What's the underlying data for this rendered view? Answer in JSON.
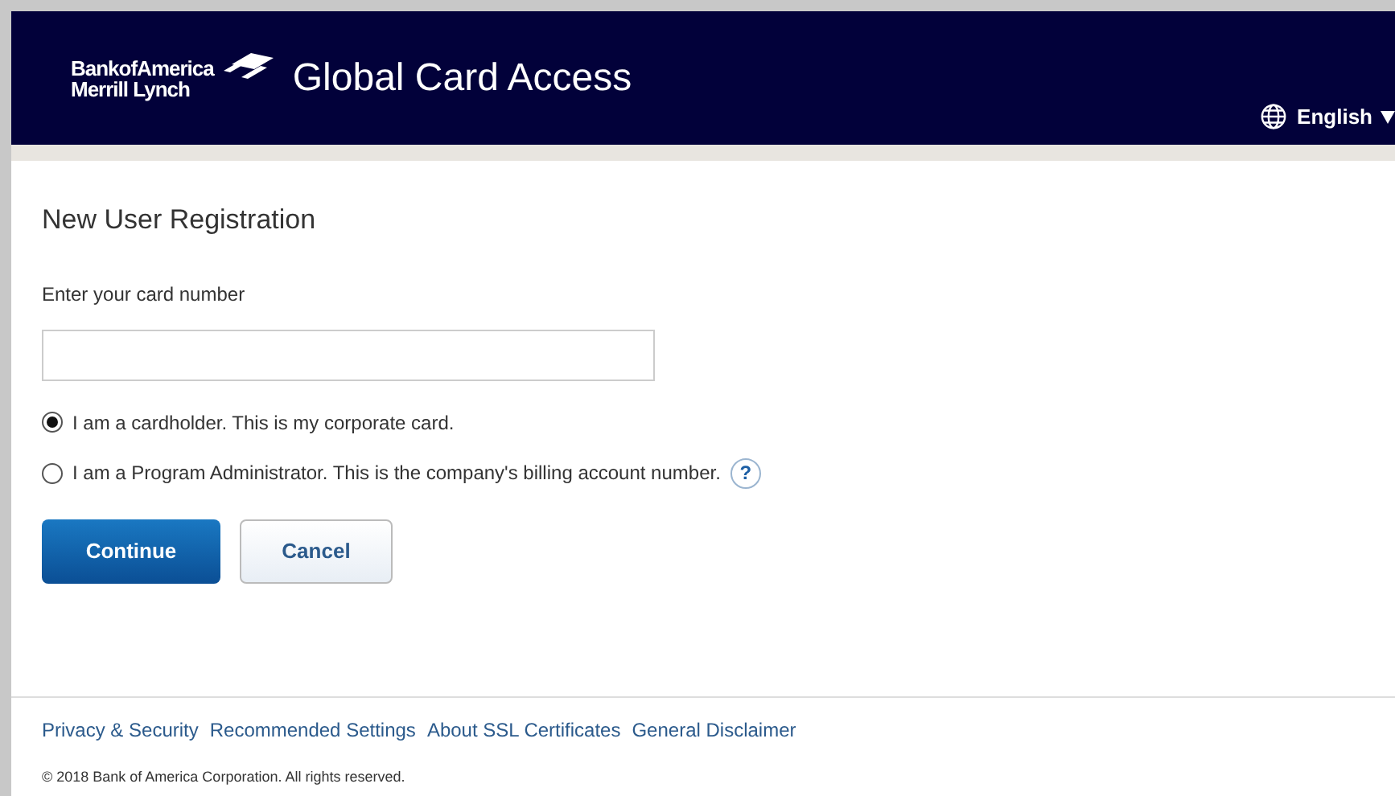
{
  "header": {
    "logo_line_1": "BankofAmerica",
    "logo_line_2": "Merrill Lynch",
    "title": "Global Card Access",
    "language": "English"
  },
  "form": {
    "heading": "New User Registration",
    "card_label": "Enter your card number",
    "options": [
      {
        "label": "I am a cardholder. This is my corporate card.",
        "selected": true
      },
      {
        "label": "I am a Program Administrator. This is the company's billing account number.",
        "selected": false,
        "help": "?"
      }
    ],
    "buttons": [
      {
        "label": "Continue",
        "kind": "primary"
      },
      {
        "label": "Cancel",
        "kind": "secondary"
      }
    ]
  },
  "footer": {
    "links": [
      "Privacy & Security",
      "Recommended Settings",
      "About SSL Certificates",
      "General Disclaimer"
    ],
    "copyright": "© 2018 Bank of America Corporation. All rights reserved."
  }
}
